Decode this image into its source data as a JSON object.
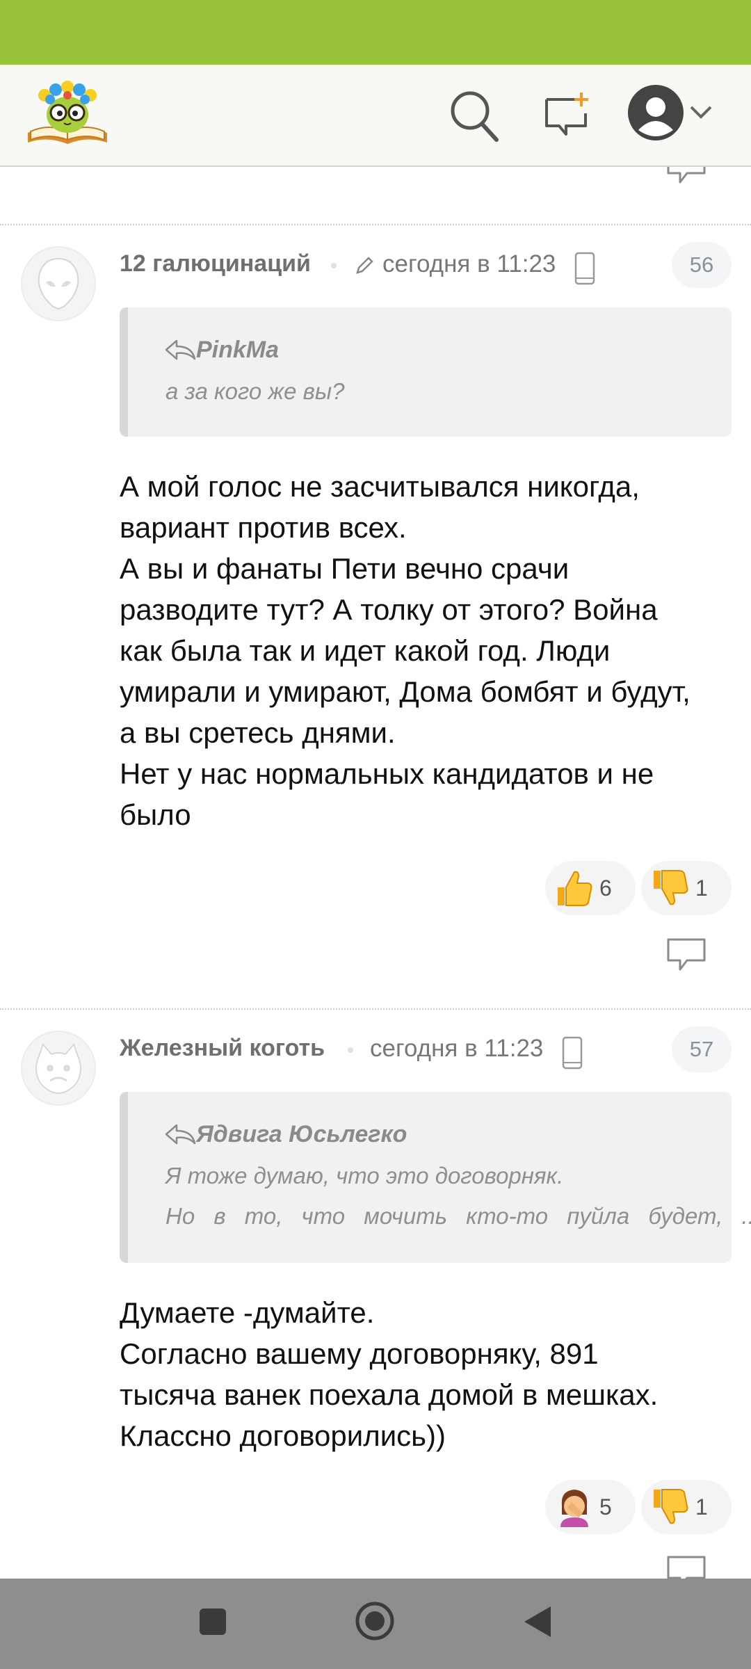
{
  "comments": [
    {
      "author": "12 галюцинаций",
      "time": "сегодня в 11:23",
      "number": "56",
      "quote_author": "PinkMa",
      "quote_lines": [
        "а за кого же вы?"
      ],
      "text": "А мой голос не засчитывался никогда,\nвариант против всех.\nА вы и фанаты Пети вечно срачи\nразводите тут? А толку от этого? Война\nкак была так и идет какой год. Люди\nумирали и умирают, Дома бомбят и будут,\nа вы сретесь днями.\nНет у нас нормальных кандидатов и не\nбыло",
      "reactions": [
        {
          "emoji": "thumbs-up-icon",
          "count": "6"
        },
        {
          "emoji": "thumbs-down-icon",
          "count": "1"
        }
      ]
    },
    {
      "author": "Железный коготь",
      "time": "сегодня в 11:23",
      "number": "57",
      "quote_author": "Ядвига Юсьлегко",
      "quote_lines": [
        "Я тоже думаю, что это договорняк.",
        "Но в то, что мочить кто-то пуйла будет, ..."
      ],
      "text": "Думаете -думайте.\nСогласно вашему договорняку, 891\nтысяча ванек поехала домой в мешках.\nКлассно договорились))",
      "reactions": [
        {
          "emoji": "facepalm-icon",
          "count": "5"
        },
        {
          "emoji": "thumbs-down-icon",
          "count": "1"
        }
      ]
    }
  ],
  "colors": {
    "status_bar": "#9ac33c",
    "header_bg": "#f8f8f4",
    "nav_bar": "#8e8e91"
  }
}
